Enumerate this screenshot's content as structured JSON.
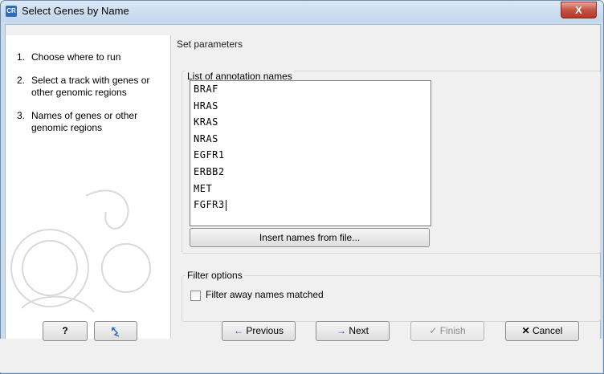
{
  "window": {
    "title": "Select Genes by Name",
    "app_icon_text": "CR",
    "close_label": "X"
  },
  "steps": [
    {
      "number": "1.",
      "label": "Choose where to run"
    },
    {
      "number": "2.",
      "label": "Select a track with genes or other genomic regions"
    },
    {
      "number": "3.",
      "label": "Names of genes or other genomic regions"
    }
  ],
  "main": {
    "section_title": "Set parameters",
    "annotation_group_label": "List of annotation names",
    "annotation_names": [
      "BRAF",
      "HRAS",
      "KRAS",
      "NRAS",
      "EGFR1",
      "ERBB2",
      "MET",
      "FGFR3"
    ],
    "insert_button": "Insert names from file...",
    "filter_group_label": "Filter options",
    "filter_checkbox_label": "Filter away names matched",
    "filter_checked": false
  },
  "footer": {
    "help": "?",
    "previous": "Previous",
    "next": "Next",
    "finish": "Finish",
    "cancel": "Cancel"
  }
}
